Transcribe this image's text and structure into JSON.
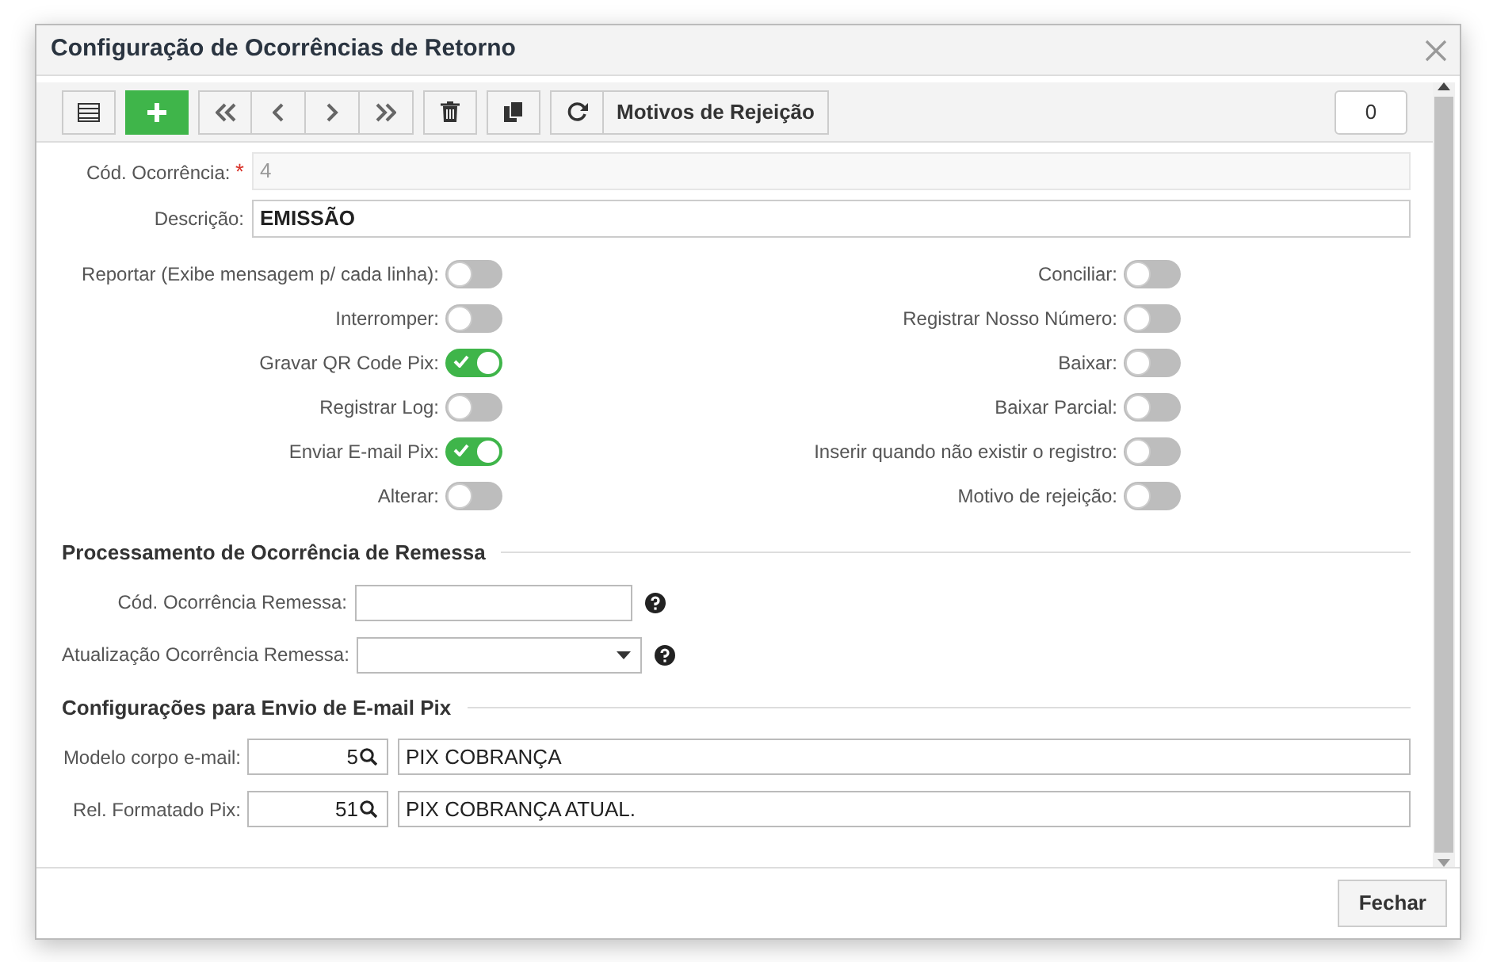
{
  "dialog": {
    "title": "Configuração de Ocorrências de Retorno"
  },
  "toolbar": {
    "rejection_button": "Motivos de Rejeição",
    "counter": "0"
  },
  "header_fields": [
    {
      "label": "Cód. Ocorrência:",
      "required_mark": "*",
      "value": "4",
      "disabled": true
    },
    {
      "label": "Descrição:",
      "value": "EMISSÃO",
      "disabled": false
    }
  ],
  "toggles_left": [
    {
      "label": "Reportar (Exibe mensagem p/ cada linha):",
      "on": false
    },
    {
      "label": "Interromper:",
      "on": false
    },
    {
      "label": "Gravar QR Code Pix:",
      "on": true
    },
    {
      "label": "Registrar Log:",
      "on": false
    },
    {
      "label": "Enviar E-mail Pix:",
      "on": true
    },
    {
      "label": "Alterar:",
      "on": false
    }
  ],
  "toggles_right": [
    {
      "label": "Conciliar:",
      "on": false
    },
    {
      "label": "Registrar Nosso Número:",
      "on": false
    },
    {
      "label": "Baixar:",
      "on": false
    },
    {
      "label": "Baixar Parcial:",
      "on": false
    },
    {
      "label": "Inserir quando não existir o registro:",
      "on": false
    },
    {
      "label": "Motivo de rejeição:",
      "on": false
    }
  ],
  "sections": [
    {
      "title": "Processamento de Ocorrência de Remessa",
      "fields": [
        {
          "kind": "text",
          "label": "Cód. Ocorrência Remessa:"
        },
        {
          "kind": "select",
          "label": "Atualização Ocorrência Remessa:"
        }
      ]
    },
    {
      "title": "Configurações para Envio de E-mail Pix",
      "fields": [
        {
          "kind": "lookup",
          "label": "Modelo corpo e-mail:",
          "code": "5",
          "value": "PIX COBRANÇA"
        },
        {
          "kind": "lookup",
          "label": "Rel. Formatado Pix:",
          "code": "51",
          "value": "PIX COBRANÇA ATUAL."
        }
      ]
    }
  ],
  "footer": {
    "close_button": "Fechar"
  }
}
